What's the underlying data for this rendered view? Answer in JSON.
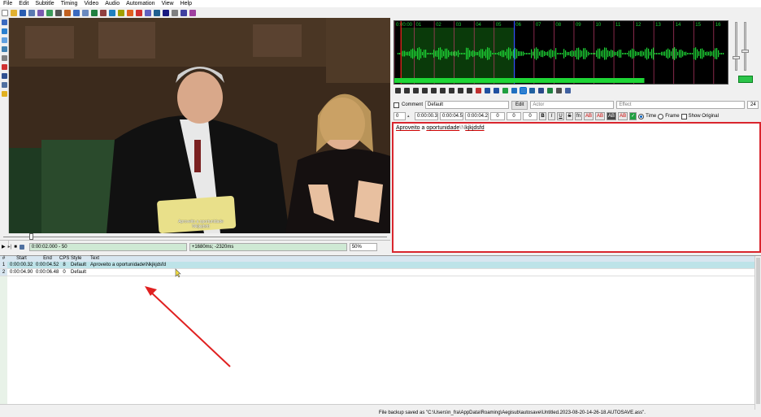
{
  "menu": [
    "File",
    "Edit",
    "Subtitle",
    "Timing",
    "Video",
    "Audio",
    "Automation",
    "View",
    "Help"
  ],
  "video": {
    "caption_line1": "Aproveito a oportunidade",
    "caption_line2": "\\Nkjkjdsfd",
    "playback_time": "0:00:02.000 - 50",
    "offset": "+1680ms; -2320ms",
    "zoom": "50%"
  },
  "audio": {
    "ruler": [
      "0:00:00",
      "01",
      "02",
      "03",
      "04",
      "05",
      "06",
      "07",
      "08",
      "09",
      "10",
      "11",
      "12",
      "13",
      "14",
      "15",
      "16"
    ],
    "playhead_fraction": 0.02,
    "selection_end_fraction": 0.36,
    "colors": {
      "wave": "#1ed636",
      "bg": "#000000",
      "sel": "#0a3a0a",
      "playhead": "#ff2020"
    }
  },
  "edit": {
    "comment_label": "Comment",
    "style": "Default",
    "edit_button": "Edit",
    "actor_placeholder": "Actor",
    "effect_placeholder": "Effect",
    "layer": "0",
    "start": "0:00:00.32",
    "end": "0:00:04.52",
    "duration": "0:00:04.20",
    "margin_l": "0",
    "margin_r": "0",
    "margin_v": "0",
    "font_size": "24",
    "format_buttons": [
      "B",
      "I",
      "U",
      "S",
      "fn",
      "AB",
      "AB",
      "AB",
      "AB"
    ],
    "time_label": "Time",
    "frame_label": "Frame",
    "show_original_label": "Show Original",
    "text_word1": "Aproveito",
    "text_mid": " a ",
    "text_word2": "oportunidade",
    "text_tail": "\\N",
    "text_word3": "kjkjdsfd"
  },
  "grid": {
    "headers": [
      "#",
      "Start",
      "End",
      "CPS",
      "Style",
      "Text"
    ],
    "rows": [
      {
        "n": "1",
        "start": "0:00:00.32",
        "end": "0:00:04.52",
        "cps": "8",
        "style": "Default",
        "text": "Aproveito a oportunidade\\Nkjkjdsfd"
      },
      {
        "n": "2",
        "start": "0:00:04.90",
        "end": "0:00:06.48",
        "cps": "0",
        "style": "Default",
        "text": ""
      }
    ]
  },
  "status": "File backup saved as \"C:\\Users\\n_fra\\AppData\\Roaming\\Aegisub\\autosave\\Untitled.2023-08-20-14-26-18.AUTOSAVE.ass\"."
}
